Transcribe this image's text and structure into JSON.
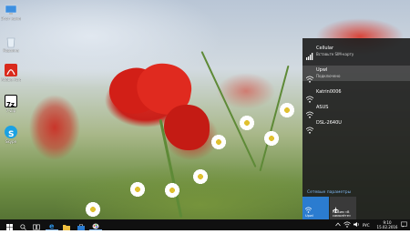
{
  "desktop_icons": [
    {
      "label": "Этот компьютер",
      "icon": "this-pc-icon"
    },
    {
      "label": "Корзина",
      "icon": "recycle-bin-icon"
    },
    {
      "label": "Adobe Acrobat",
      "icon": "acrobat-icon"
    },
    {
      "label": "7-Zip",
      "icon": "7zip-icon"
    },
    {
      "label": "Skype",
      "icon": "skype-icon"
    }
  ],
  "network_panel": {
    "networks": [
      {
        "name": "Cellular",
        "status": "Вставьте SIM-карту",
        "icon": "cellular-icon"
      },
      {
        "name": "Upwl",
        "status": "Подключено",
        "icon": "wifi-icon"
      },
      {
        "name": "Katrin0006",
        "status": "",
        "icon": "wifi-icon"
      },
      {
        "name": "ASUS",
        "status": "",
        "icon": "wifi-icon"
      },
      {
        "name": "DSL-2640U",
        "status": "",
        "icon": "wifi-icon"
      }
    ],
    "settings_link": "Сетевые параметры",
    "tiles": [
      {
        "label": "Upwl",
        "icon": "wifi-icon"
      },
      {
        "label": "Режим «В самолёте»",
        "icon": "airplane-icon"
      }
    ]
  },
  "taskbar": {
    "language": "РУС",
    "time": "9:10",
    "date": "15.02.2016"
  },
  "colors": {
    "accent": "#2b7cd0",
    "panel_bg": "#1f1f1f",
    "link": "#7fb6f2"
  }
}
